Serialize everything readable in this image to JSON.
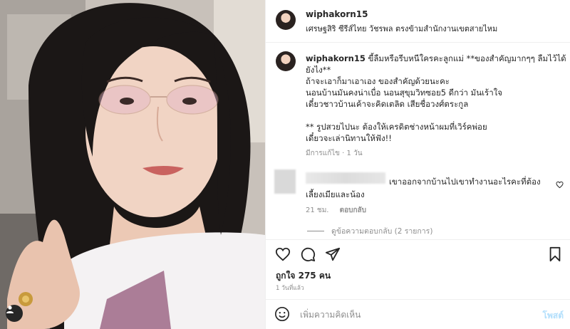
{
  "post": {
    "username": "wiphakorn15",
    "location": "เศรษฐสิริ ซีรีส์ไทย วัชรพล ตรงข้ามสำนักงานเขตสายไหม"
  },
  "caption": {
    "username": "wiphakorn15",
    "lines": [
      "ขี้ลืมหรือรีบหนีใครคะลูกแม่ **ของสำคัญมากๆๆ ลืมไว้ได้",
      "ยังไง**",
      "ถ้าจะเอาก็มาเอาเอง ของสำคัญด้วยนะคะ",
      "นอนบ้านมันคงน่าเบื่อ นอนสุขุมวิทซอย5 ดีกว่า มันเร้าใจ",
      "เดี๋ยวชาวบ้านเค้าจะคิดเตลิด เสียชื่อวงศ์ตระกูล",
      "",
      "** รูปสวยไปนะ ต้องให้เครดิตช่างหน้าผมที่เวิร์คพ่อย",
      "เดี๋ยวจะเล่านิทานให้ฟัง!!"
    ],
    "meta": "มีการแก้ไข · 1 วัน"
  },
  "comment": {
    "text_line1": "เขาออกจากบ้านไปเขาทำงานอะไรคะที่ต้อง",
    "text_line2": "เลี้ยงเมียและน้อง",
    "time": "21 ชม.",
    "reply_label": "ตอบกลับ",
    "view_replies": "ดูข้อความตอบกลับ (2 รายการ)"
  },
  "likes": "ถูกใจ 275 คน",
  "date": "1 วันที่แล้ว",
  "composer": {
    "placeholder": "เพิ่มความคิดเห็น",
    "post_label": "โพสต์"
  },
  "icons": {
    "like": "heart-icon",
    "comment": "comment-icon",
    "share": "share-icon",
    "save": "bookmark-icon",
    "emoji": "emoji-icon",
    "tag": "user-tag-icon"
  },
  "colors": {
    "text": "#262626",
    "muted": "#8e8e8e",
    "post_button": "#b2dffc",
    "divider": "#efefef"
  }
}
